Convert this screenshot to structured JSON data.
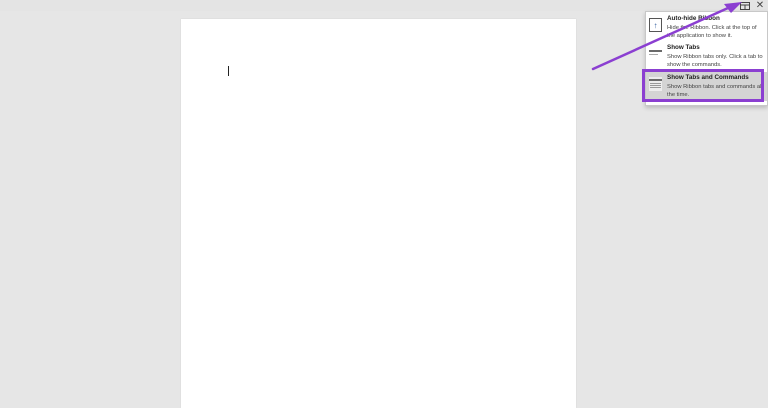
{
  "titlebar": {
    "more_label": "···",
    "ribbon_display_label": "⊞",
    "close_label": "✕"
  },
  "ribbon_display_menu": {
    "items": [
      {
        "title": "Auto-hide Ribbon",
        "description": "Hide the Ribbon. Click at the top of the application to show it.",
        "icon": "auto-hide-ribbon-icon"
      },
      {
        "title": "Show Tabs",
        "description": "Show Ribbon tabs only. Click a tab to show the commands.",
        "icon": "show-tabs-icon"
      },
      {
        "title": "Show Tabs and Commands",
        "description": "Show Ribbon tabs and commands all the time.",
        "icon": "show-tabs-and-commands-icon",
        "highlighted": true
      }
    ],
    "auto_hide_glyph": "↑"
  },
  "colors": {
    "annotation": "#8b3fd1",
    "highlighted_item_bg": "#d4d4d4",
    "background": "#e6e6e6",
    "page": "#ffffff"
  }
}
